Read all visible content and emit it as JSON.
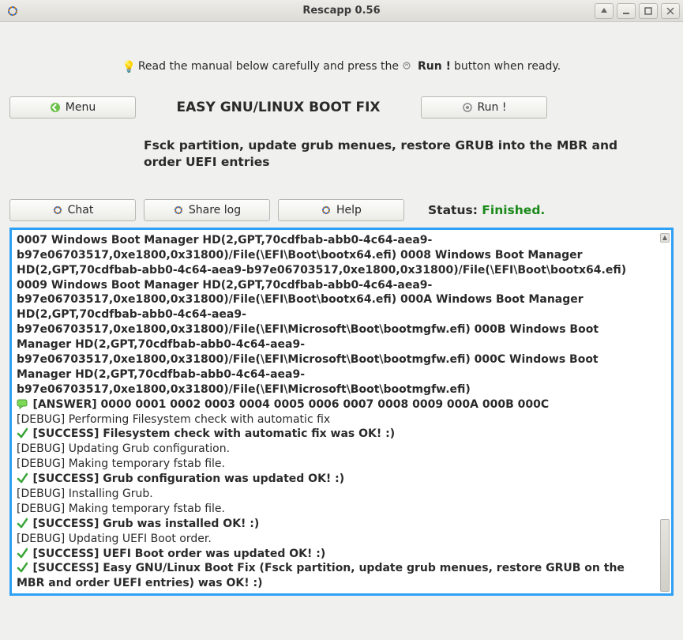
{
  "window": {
    "title": "Rescapp 0.56"
  },
  "instruction": {
    "prefix": "Read the manual below carefully and press the ",
    "runword": "Run !",
    "suffix": " button when ready."
  },
  "buttons": {
    "menu": "Menu",
    "run": "Run !",
    "chat": "Chat",
    "sharelog": "Share log",
    "help": "Help"
  },
  "heading": "EASY GNU/LINUX BOOT FIX",
  "description": "Fsck partition, update grub menues, restore GRUB into the MBR and order UEFI entries",
  "status": {
    "label": "Status: ",
    "value": "Finished."
  },
  "log": {
    "bootblock": "0007 Windows Boot Manager HD(2,GPT,70cdfbab-abb0-4c64-aea9-b97e06703517,0xe1800,0x31800)/File(\\EFI\\Boot\\bootx64.efi) 0008 Windows Boot Manager HD(2,GPT,70cdfbab-abb0-4c64-aea9-b97e06703517,0xe1800,0x31800)/File(\\EFI\\Boot\\bootx64.efi) 0009 Windows Boot Manager HD(2,GPT,70cdfbab-abb0-4c64-aea9-b97e06703517,0xe1800,0x31800)/File(\\EFI\\Boot\\bootx64.efi) 000A Windows Boot Manager HD(2,GPT,70cdfbab-abb0-4c64-aea9-b97e06703517,0xe1800,0x31800)/File(\\EFI\\Microsoft\\Boot\\bootmgfw.efi) 000B Windows Boot Manager HD(2,GPT,70cdfbab-abb0-4c64-aea9-b97e06703517,0xe1800,0x31800)/File(\\EFI\\Microsoft\\Boot\\bootmgfw.efi) 000C Windows Boot Manager HD(2,GPT,70cdfbab-abb0-4c64-aea9-b97e06703517,0xe1800,0x31800)/File(\\EFI\\Microsoft\\Boot\\bootmgfw.efi)",
    "lines": [
      {
        "type": "answer",
        "text": "[ANSWER] 0000 0001 0002 0003 0004 0005 0006 0007 0008 0009 000A 000B 000C"
      },
      {
        "type": "debug",
        "text": "[DEBUG] Performing Filesystem check with automatic fix"
      },
      {
        "type": "success",
        "text": "[SUCCESS] Filesystem check with automatic fix was OK! :)"
      },
      {
        "type": "debug",
        "text": "[DEBUG] Updating Grub configuration."
      },
      {
        "type": "debug",
        "text": "[DEBUG] Making temporary fstab file."
      },
      {
        "type": "success",
        "text": "[SUCCESS] Grub configuration was updated OK! :)"
      },
      {
        "type": "debug",
        "text": "[DEBUG] Installing Grub."
      },
      {
        "type": "debug",
        "text": "[DEBUG] Making temporary fstab file."
      },
      {
        "type": "success",
        "text": "[SUCCESS] Grub was installed OK! :)"
      },
      {
        "type": "debug",
        "text": "[DEBUG] Updating UEFI Boot order."
      },
      {
        "type": "success",
        "text": "[SUCCESS] UEFI Boot order was updated OK! :)"
      },
      {
        "type": "success",
        "text": "[SUCCESS] Easy GNU/Linux Boot Fix (Fsck partition, update grub menues, restore GRUB on the MBR and order UEFI entries) was OK! :)"
      }
    ]
  }
}
